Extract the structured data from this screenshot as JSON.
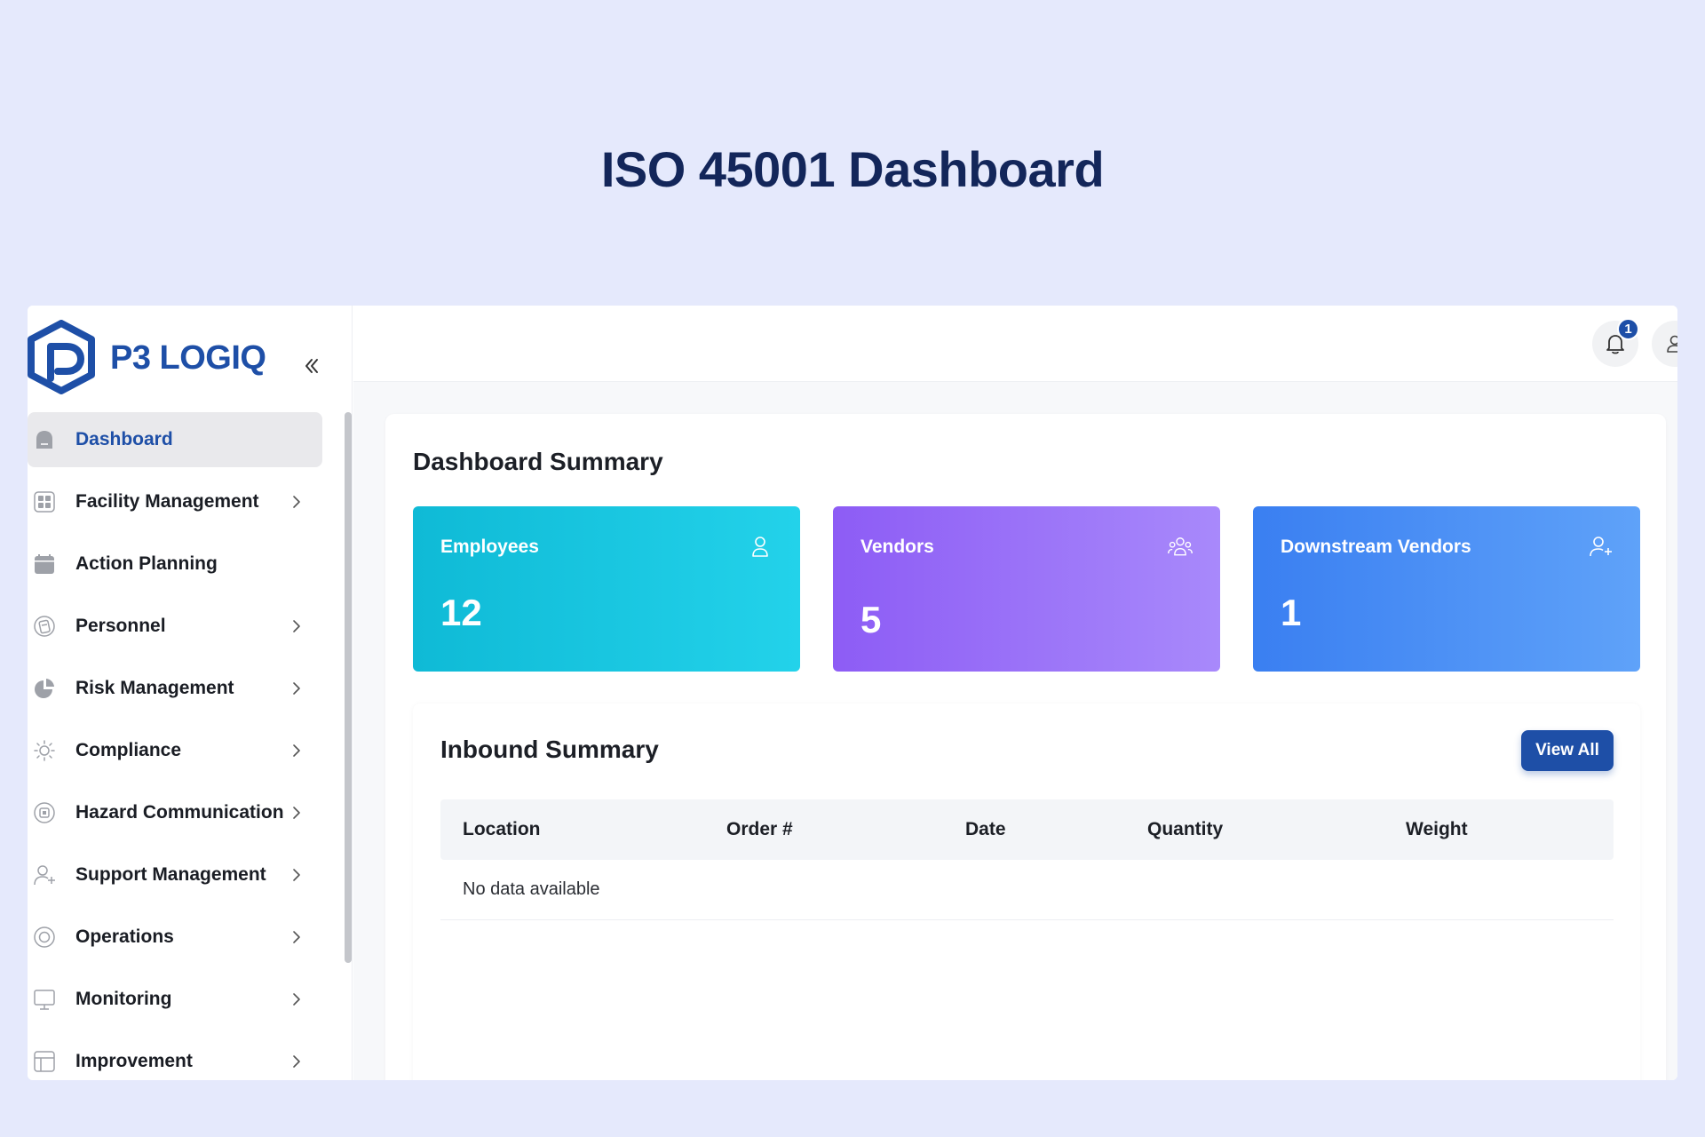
{
  "page": {
    "heading": "ISO 45001 Dashboard"
  },
  "brand": {
    "name": "P3 LOGIQ",
    "color": "#1e4fa7"
  },
  "sidebar": {
    "items": [
      {
        "label": "Dashboard",
        "icon": "home-icon",
        "active": true,
        "chevron": false
      },
      {
        "label": "Facility Management",
        "icon": "grid-icon",
        "chevron": true
      },
      {
        "label": "Action Planning",
        "icon": "calendar-icon",
        "chevron": false
      },
      {
        "label": "Personnel",
        "icon": "id-badge-icon",
        "chevron": true
      },
      {
        "label": "Risk Management",
        "icon": "pie-chart-icon",
        "chevron": true
      },
      {
        "label": "Compliance",
        "icon": "sun-icon",
        "chevron": true
      },
      {
        "label": "Hazard Communication",
        "icon": "chip-icon",
        "chevron": true
      },
      {
        "label": "Support Management",
        "icon": "user-plus-icon",
        "chevron": true
      },
      {
        "label": "Operations",
        "icon": "target-icon",
        "chevron": true
      },
      {
        "label": "Monitoring",
        "icon": "monitor-icon",
        "chevron": true
      },
      {
        "label": "Improvement",
        "icon": "layout-icon",
        "chevron": true
      }
    ]
  },
  "topbar": {
    "notification_count": "1"
  },
  "summary": {
    "title": "Dashboard Summary",
    "stats": [
      {
        "label": "Employees",
        "value": "12",
        "icon": "user-icon"
      },
      {
        "label": "Vendors",
        "value": "5",
        "icon": "users-icon"
      },
      {
        "label": "Downstream Vendors",
        "value": "1",
        "icon": "user-plus-icon"
      }
    ]
  },
  "inbound": {
    "title": "Inbound Summary",
    "view_all": "View All",
    "columns": [
      "Location",
      "Order #",
      "Date",
      "Quantity",
      "Weight"
    ],
    "empty": "No data available"
  }
}
